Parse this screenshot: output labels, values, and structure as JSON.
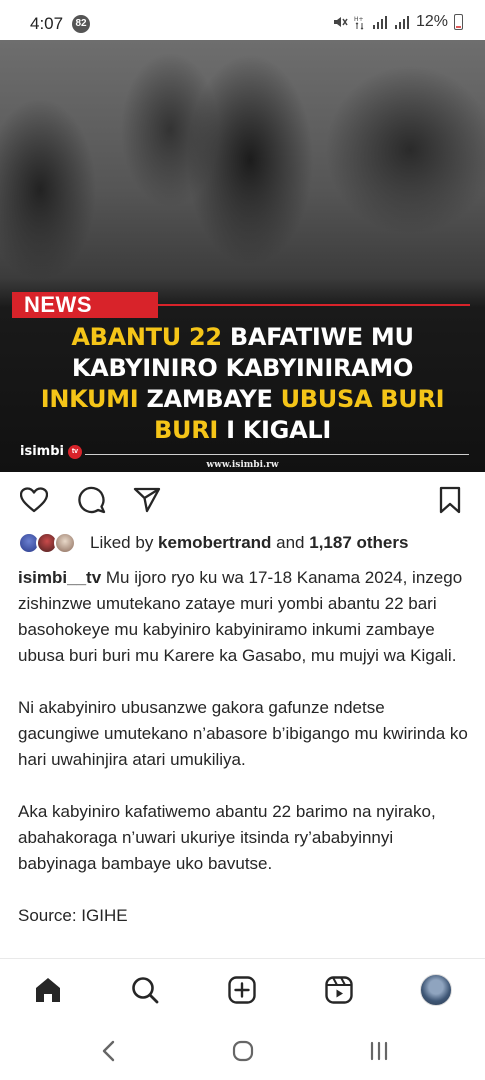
{
  "status_bar": {
    "time": "4:07",
    "notification_count": "82",
    "battery": "12%"
  },
  "post": {
    "image": {
      "tag": "NEWS",
      "headline": {
        "line1_a": "ABANTU 22",
        "line1_b": " BAFATIWE MU",
        "line2": "KABYINIRO KABYINIRAMO",
        "line3_a": "INKUMI",
        "line3_b": " ZAMBAYE ",
        "line3_c": "UBUSA BURI",
        "line4_a": "BURI",
        "line4_b": " I KIGALI"
      },
      "brand": "isimbi",
      "brand_badge": "tv",
      "url": "www.isimbi.rw"
    },
    "likes": {
      "prefix": "Liked by ",
      "user": "kemobertrand",
      "middle": " and ",
      "count": "1,187 others"
    },
    "caption": {
      "username": "isimbi__tv",
      "p1": "Mu ijoro ryo ku wa 17-18 Kanama 2024, inzego zishinzwe umutekano zataye muri yombi abantu 22 bari basohokeye mu kabyiniro kabyiniramo inkumi zambaye ubusa buri buri mu Karere ka Gasabo, mu mujyi wa Kigali.",
      "p2": "Ni akabyiniro ubusanzwe gakora gafunze ndetse gacungiwe umutekano n’abasore b’ibigango mu kwirinda ko hari uwahinjira atari umukiliya.",
      "p3": "Aka kabyiniro kafatiwemo abantu 22 barimo na nyirako, abahakoraga n’uwari ukuriye itsinda ry’ababyinnyi babyinaga bambaye uko bavutse.",
      "source": "Source: IGIHE"
    }
  },
  "colors": {
    "news_red": "#d8232a",
    "headline_yellow": "#f5c518"
  }
}
